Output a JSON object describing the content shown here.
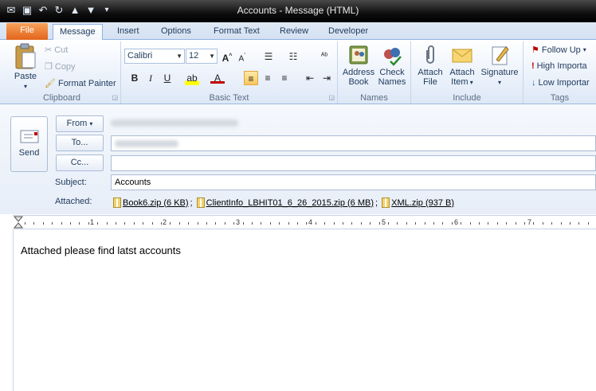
{
  "window": {
    "title": "Accounts - Message (HTML)"
  },
  "tabs": [
    "File",
    "Message",
    "Insert",
    "Options",
    "Format Text",
    "Review",
    "Developer"
  ],
  "ribbon": {
    "clipboard": {
      "label": "Clipboard",
      "paste": "Paste",
      "cut": "Cut",
      "copy": "Copy",
      "format_painter": "Format Painter"
    },
    "basic_text": {
      "label": "Basic Text",
      "font": "Calibri",
      "size": "12"
    },
    "names": {
      "label": "Names",
      "address_book_1": "Address",
      "address_book_2": "Book",
      "check_names_1": "Check",
      "check_names_2": "Names"
    },
    "include": {
      "label": "Include",
      "attach_file_1": "Attach",
      "attach_file_2": "File",
      "attach_item_1": "Attach",
      "attach_item_2": "Item",
      "signature": "Signature"
    },
    "tags": {
      "label": "Tags",
      "follow_up": "Follow Up",
      "high": "High Importa",
      "low": "Low Importar"
    }
  },
  "compose": {
    "send": "Send",
    "from_btn": "From",
    "to_btn": "To...",
    "cc_btn": "Cc...",
    "subject_label": "Subject:",
    "subject_value": "Accounts",
    "attached_label": "Attached:",
    "attachments": [
      {
        "name": "Book6.zip (6 KB)",
        "sep": ";"
      },
      {
        "name": "ClientInfo_LBHIT01_6_26_2015.zip (6 MB)",
        "sep": ";"
      },
      {
        "name": "XML.zip (937 B)",
        "sep": ""
      }
    ]
  },
  "ruler": {
    "marks": [
      "1",
      "2",
      "3",
      "4",
      "5",
      "6",
      "7"
    ]
  },
  "body": {
    "text": "Attached please find latst accounts"
  }
}
